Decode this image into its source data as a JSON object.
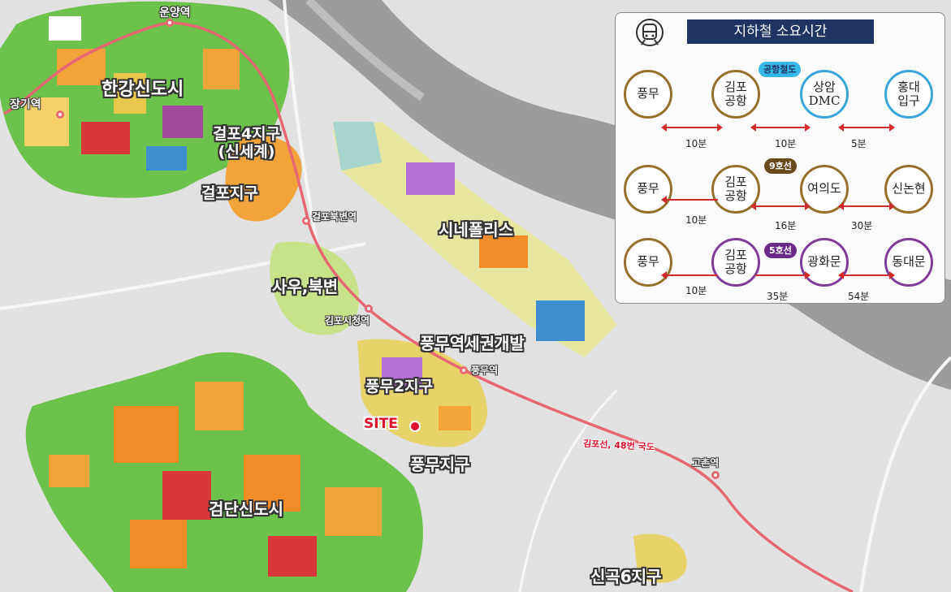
{
  "panel": {
    "title": "지하철 소요시간",
    "icon": "subway-train-icon",
    "rows": [
      {
        "stations": [
          "풍무",
          "김포\n공항",
          "상암\nDMC",
          "홍대\n입구"
        ],
        "line_badge": "공항철도",
        "line_color": "#38a6d6",
        "durations": [
          "10분",
          "10분",
          "5분"
        ]
      },
      {
        "stations": [
          "풍무",
          "김포\n공항",
          "여의도",
          "신논현"
        ],
        "line_badge": "9호선",
        "line_color": "#94702c",
        "durations": [
          "10분",
          "16분",
          "30분"
        ]
      },
      {
        "stations": [
          "풍무",
          "김포\n공항",
          "광화문",
          "동대문"
        ],
        "line_badge": "5호선",
        "line_color": "#7e3b97",
        "durations": [
          "10분",
          "35분",
          "54분"
        ]
      }
    ]
  },
  "areas": {
    "hangang": "한강신도시",
    "geolpo4": "걸포4지구\n(신세계)",
    "geolpo": "걸포지구",
    "cinepolis": "시네폴리스",
    "sau": "사우,북변",
    "pungmu_station_dev": "풍무역세권개발",
    "pungmu2": "풍무2지구",
    "pungmu": "풍무지구",
    "geomdan": "검단신도시",
    "singok6": "신곡6지구"
  },
  "stations": {
    "uunyang": "운양역",
    "janggi": "장기역",
    "geolpo_bukbyeon": "걸포북변역",
    "gimpo_cityhall": "김포시청역",
    "pungmu": "풍무역",
    "gochon": "고촌역"
  },
  "site": "SITE",
  "route": "김포선, 48번 국도",
  "colors": {
    "rail": "#e56873",
    "river": "#9a9a9a",
    "panel_title_bg": "#1e3564"
  }
}
